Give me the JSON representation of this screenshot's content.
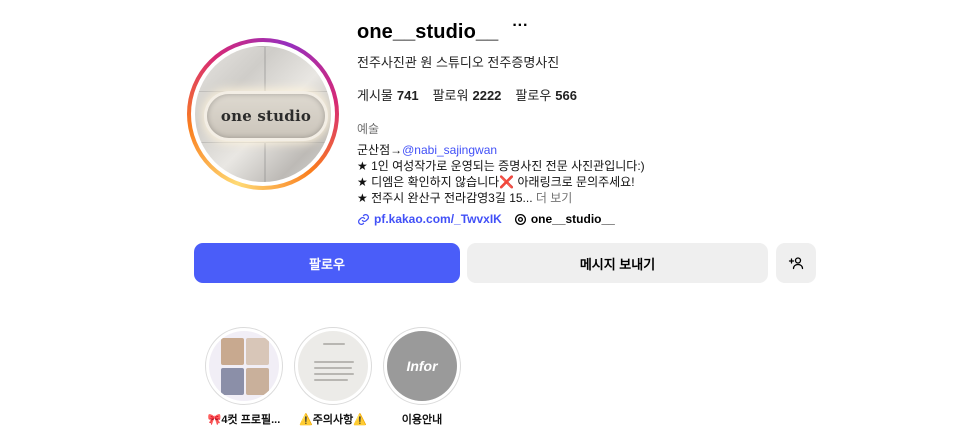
{
  "profile": {
    "username": "one__studio__",
    "more_icon": "···",
    "full_name": "전주사진관 원 스튜디오 전주증명사진",
    "avatar_sign_text": "one studio",
    "stats": {
      "posts_label": "게시물",
      "posts_value": "741",
      "followers_label": "팔로워",
      "followers_value": "2222",
      "following_label": "팔로우",
      "following_value": "566"
    },
    "category": "예술",
    "bio": {
      "line1_prefix": "군산점→",
      "line1_mention": "@nabi_sajingwan",
      "line2": "★ 1인 여성작가로 운영되는 증명사진 전문 사진관입니다:)",
      "line3_prefix": "★ 디엠은 확인하지 않습니다",
      "line3_emoji": "❌",
      "line3_suffix": " 아래링크로 문의주세요!",
      "line4": "★ 전주시 완산구 전라감영3길 15...",
      "more": " 더 보기"
    },
    "link_text": "pf.kakao.com/_TwvxIK",
    "threads_handle": "one__studio__"
  },
  "buttons": {
    "follow": "팔로우",
    "message": "메시지 보내기",
    "add_user": "+옷"
  },
  "highlights": [
    {
      "label": "🎀4컷 프로필..."
    },
    {
      "label": "⚠️주의사항⚠️"
    },
    {
      "label": "이용안내",
      "cover_text": "Infor"
    }
  ],
  "colors": {
    "primary_button": "#4a5df9",
    "link": "#4150f7",
    "secondary_button": "#efefef"
  }
}
